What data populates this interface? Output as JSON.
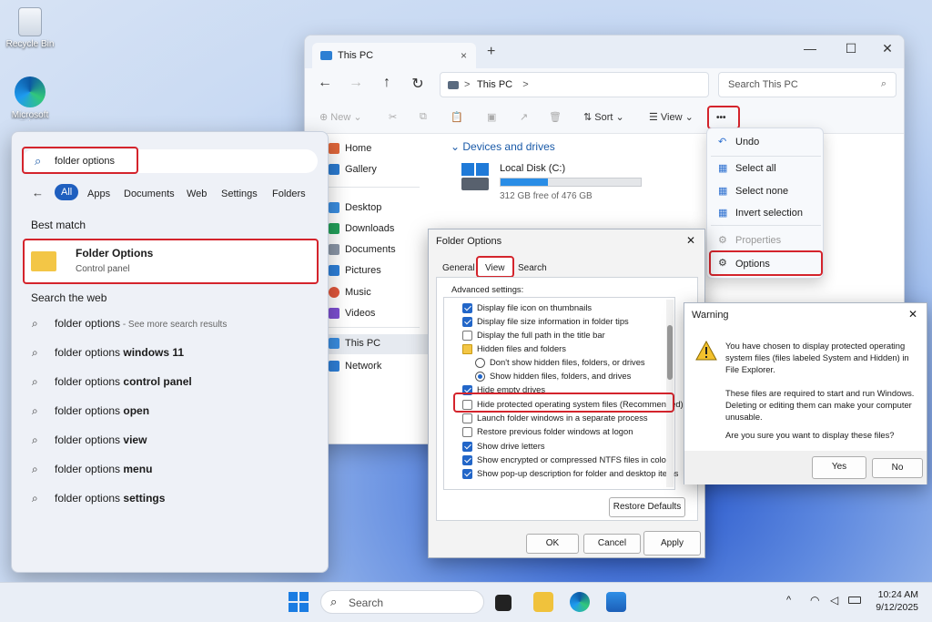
{
  "desktop": {
    "recycle_label": "Recycle Bin",
    "edge_label": "Microsoft Edge"
  },
  "explorer": {
    "tab_title": "This PC",
    "tab_close": "×",
    "new_tab": "+",
    "minimize": "—",
    "maximize": "☐",
    "close": "✕",
    "nav": {
      "back": "←",
      "forward": "→",
      "up": "↑",
      "refresh": "↻"
    },
    "breadcrumb": "This PC",
    "breadcrumb_sep": ">",
    "breadcrumb_sep2": ">",
    "search_placeholder": "Search This PC",
    "cmd": {
      "new": "New",
      "sort": "Sort",
      "view": "View",
      "more": "•••"
    },
    "sidebar": [
      {
        "label": "Home",
        "color": "#e0663a"
      },
      {
        "label": "Gallery",
        "color": "#2b7bd0"
      },
      {
        "label": "Desktop",
        "color": "#3a8de0"
      },
      {
        "label": "Downloads",
        "color": "#23a05a"
      },
      {
        "label": "Documents",
        "color": "#8a95a5"
      },
      {
        "label": "Pictures",
        "color": "#2e7fd8"
      },
      {
        "label": "Music",
        "color": "#e0563a"
      },
      {
        "label": "Videos",
        "color": "#7d4fd0"
      },
      {
        "label": "This PC",
        "color": "#3a8de0"
      },
      {
        "label": "Network",
        "color": "#2e7fd8"
      }
    ],
    "section_title": "Devices and drives",
    "drive": {
      "name": "Local Disk (C:)",
      "free": "312 GB free of 476 GB",
      "used_fraction": 0.34
    }
  },
  "context_menu": {
    "items": [
      {
        "label": "Undo",
        "icon": "↶"
      },
      {
        "label": "Select all",
        "icon": "▦"
      },
      {
        "label": "Select none",
        "icon": "▦"
      },
      {
        "label": "Invert selection",
        "icon": "▦"
      },
      {
        "label": "Properties",
        "icon": "⚙"
      },
      {
        "label": "Options",
        "icon": "⚙"
      }
    ]
  },
  "start_menu": {
    "query": "folder options",
    "filters": [
      "All",
      "Apps",
      "Documents",
      "Web",
      "Settings",
      "Folders"
    ],
    "best_match_heading": "Best match",
    "best_match": {
      "title": "Folder Options",
      "subtitle": "Control panel"
    },
    "web_heading": "Search the web",
    "web_results": [
      {
        "plain": "folder options",
        "bold": "",
        "suffix": " - See more search results"
      },
      {
        "plain": "folder options ",
        "bold": "windows 11",
        "suffix": ""
      },
      {
        "plain": "folder options ",
        "bold": "control panel",
        "suffix": ""
      },
      {
        "plain": "folder options ",
        "bold": "open",
        "suffix": ""
      },
      {
        "plain": "folder options ",
        "bold": "view",
        "suffix": ""
      },
      {
        "plain": "folder options ",
        "bold": "menu",
        "suffix": ""
      },
      {
        "plain": "folder options ",
        "bold": "settings",
        "suffix": ""
      }
    ]
  },
  "folder_options": {
    "title": "Folder Options",
    "close": "✕",
    "tabs": [
      "General",
      "View",
      "Search"
    ],
    "advanced_label": "Advanced settings:",
    "options": [
      {
        "type": "check",
        "checked": true,
        "label": "Display file icon on thumbnails"
      },
      {
        "type": "check",
        "checked": true,
        "label": "Display file size information in folder tips"
      },
      {
        "type": "check",
        "checked": false,
        "label": "Display the full path in the title bar"
      },
      {
        "type": "folder",
        "checked": false,
        "label": "Hidden files and folders"
      },
      {
        "type": "radio",
        "checked": false,
        "label": "Don't show hidden files, folders, or drives"
      },
      {
        "type": "radio",
        "checked": true,
        "label": "Show hidden files, folders, and drives"
      },
      {
        "type": "check",
        "checked": true,
        "label": "Hide empty drives"
      },
      {
        "type": "check",
        "checked": false,
        "label": "Hide protected operating system files (Recommended)"
      },
      {
        "type": "check",
        "checked": false,
        "label": "Launch folder windows in a separate process"
      },
      {
        "type": "check",
        "checked": false,
        "label": "Restore previous folder windows at logon"
      },
      {
        "type": "check",
        "checked": true,
        "label": "Show drive letters"
      },
      {
        "type": "check",
        "checked": true,
        "label": "Show encrypted or compressed NTFS files in color"
      },
      {
        "type": "check",
        "checked": true,
        "label": "Show pop-up description for folder and desktop items"
      }
    ],
    "restore_defaults": "Restore Defaults",
    "ok": "OK",
    "cancel": "Cancel",
    "apply": "Apply"
  },
  "warning": {
    "title": "Warning",
    "close": "✕",
    "line1": "You have chosen to display protected operating system files (files labeled System and Hidden) in File Explorer.",
    "line2": "These files are required to start and run Windows. Deleting or editing them can make your computer unusable.",
    "line3": "Are you sure you want to display these files?",
    "yes": "Yes",
    "no": "No"
  },
  "taskbar": {
    "search": "Search",
    "time": "10:24 AM",
    "date": "9/12/2025",
    "chevron": "^"
  }
}
